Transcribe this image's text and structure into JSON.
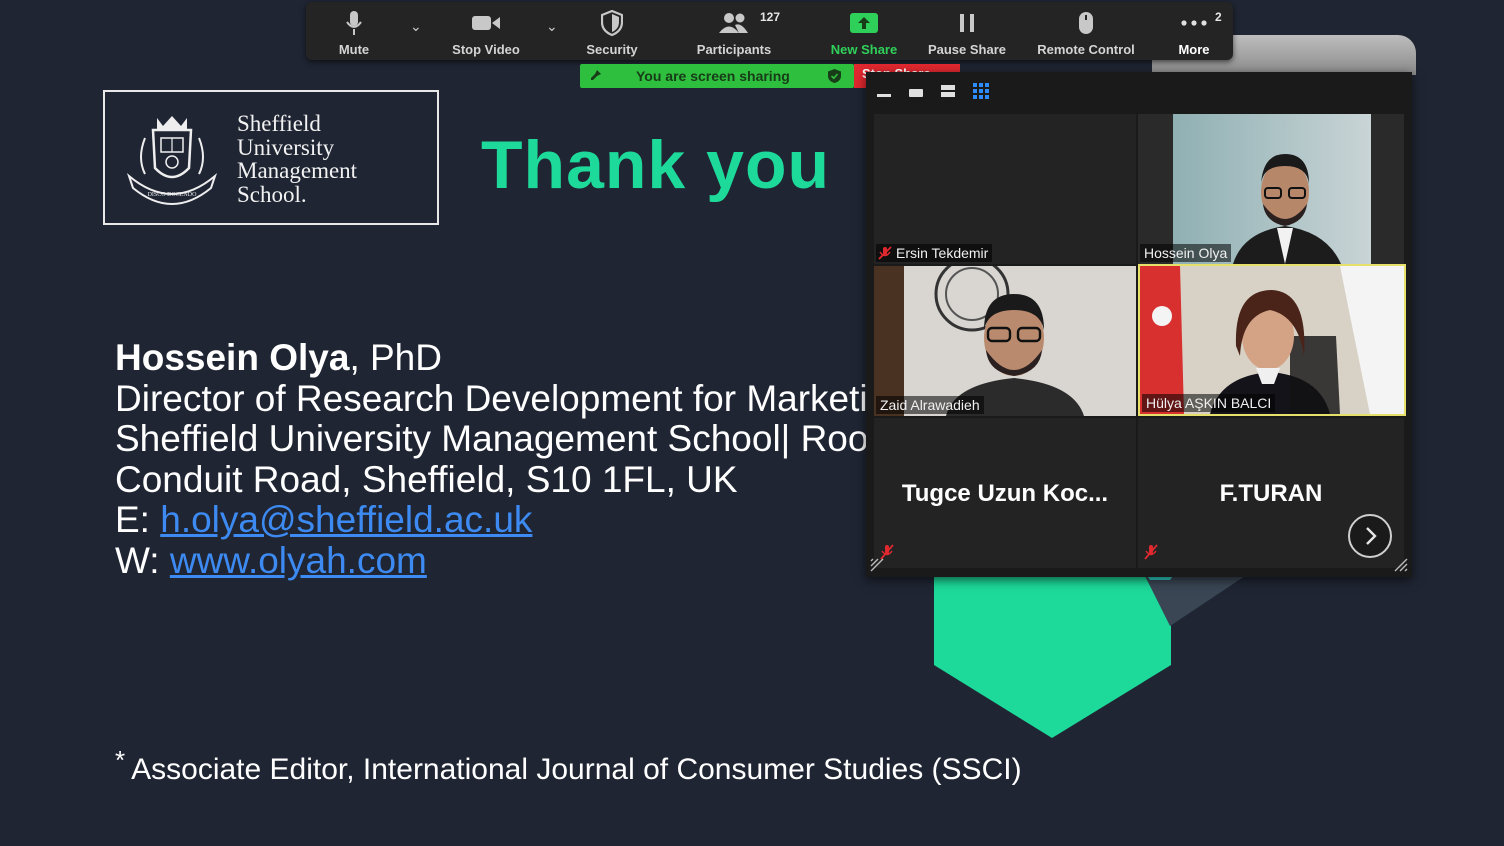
{
  "toolbar": {
    "mute": "Mute",
    "stop_video": "Stop Video",
    "security": "Security",
    "participants": "Participants",
    "participants_count": "127",
    "new_share": "New Share",
    "pause_share": "Pause Share",
    "remote_control": "Remote Control",
    "more": "More",
    "more_badge": "2"
  },
  "share_status": {
    "message": "You are screen sharing",
    "stop_label": "Stop Share"
  },
  "slide": {
    "logo_lines": [
      "Sheffield",
      "University",
      "Management",
      "School."
    ],
    "crest_motto": "DISCO DOCENDO",
    "heading": "Thank you",
    "name": "Hossein Olya",
    "name_suffix": ", PhD",
    "role_line": "Director of Research Development for Marketing",
    "org_line": "Sheffield University Management School| Room",
    "address_line": "Conduit Road, Sheffield, S10 1FL, UK",
    "email_prefix": "E: ",
    "email": "h.olya@sheffield.ac.uk",
    "web_prefix": "W: ",
    "web": "www.olyah.com",
    "footnote_mark": "*",
    "footnote": "Associate Editor, International Journal of Consumer Studies (SSCI)"
  },
  "gallery": {
    "participants": [
      {
        "name": "Ersin Tekdemir",
        "muted": true,
        "video": false
      },
      {
        "name": "Hossein Olya",
        "muted": false,
        "video": true
      },
      {
        "name": "Zaid Alrawadieh",
        "muted": false,
        "video": true
      },
      {
        "name": "Hülya AŞKIN BALCI",
        "muted": false,
        "video": true,
        "speaking": true
      },
      {
        "name": "Tugce Uzun Koc...",
        "muted": true,
        "video": false
      },
      {
        "name": "F.TURAN",
        "muted": true,
        "video": false
      }
    ]
  },
  "colors": {
    "background": "#1f2533",
    "accent_green": "#1dd99a",
    "link_blue": "#3d8bf2",
    "share_green": "#2fbf3f",
    "stop_red": "#e0282f",
    "speaker_highlight": "#e6e06a"
  }
}
